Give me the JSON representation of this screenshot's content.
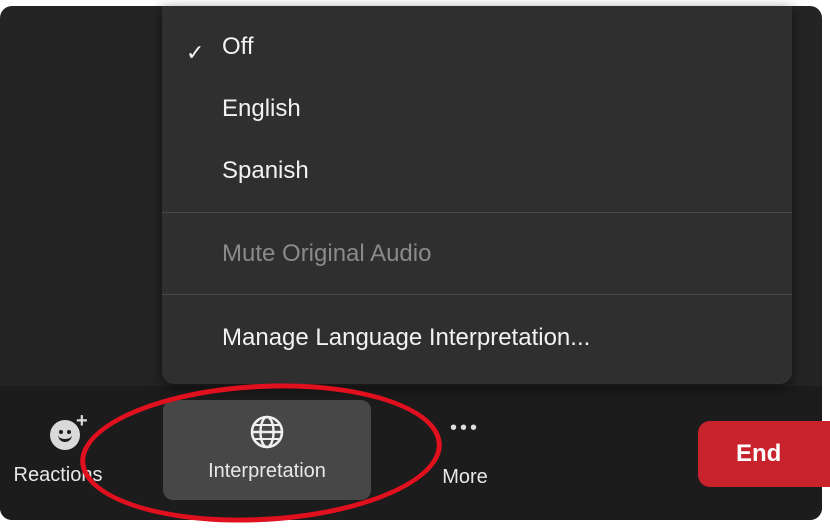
{
  "menu": {
    "items": [
      {
        "label": "Off",
        "checked": true
      },
      {
        "label": "English",
        "checked": false
      },
      {
        "label": "Spanish",
        "checked": false
      }
    ],
    "mute_label": "Mute Original Audio",
    "mute_enabled": false,
    "manage_label": "Manage Language Interpretation..."
  },
  "toolbar": {
    "reactions_label": "Reactions",
    "interpretation_label": "Interpretation",
    "more_label": "More",
    "end_label": "End"
  },
  "icons": {
    "check": "checkmark-icon",
    "reactions": "smiley-plus-icon",
    "interpretation": "globe-icon",
    "more": "ellipsis-icon"
  },
  "colors": {
    "end_button": "#c8232d",
    "annotation": "#e0101e",
    "active_tab_bg": "#474747"
  }
}
